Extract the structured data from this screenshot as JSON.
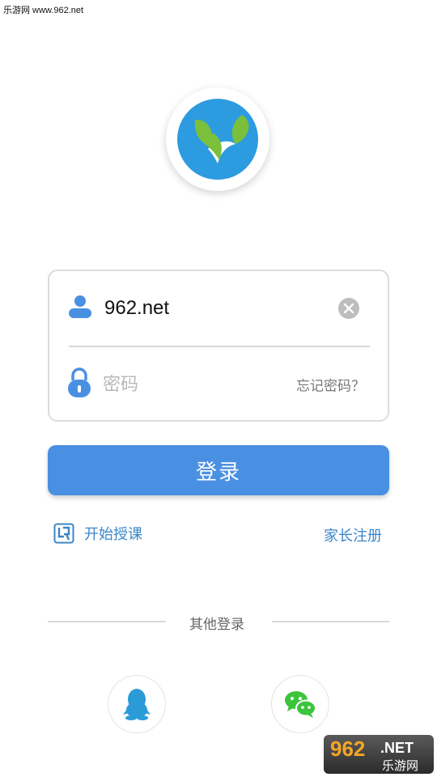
{
  "watermark": {
    "top_text": "乐游网 www.962.net",
    "badge_number": "962",
    "badge_suffix": ".NET",
    "badge_cn": "乐游网"
  },
  "login_form": {
    "username_value": "962.net",
    "password_placeholder": "密码",
    "forgot_label": "忘记密码？"
  },
  "login_button_label": "登录",
  "links": {
    "start_teaching": "开始授课",
    "parent_register": "家长注册"
  },
  "other_login": {
    "label": "其他登录",
    "providers": [
      "qq-icon",
      "wechat-icon"
    ]
  },
  "colors": {
    "accent": "#4a90e2",
    "link": "#3b86c9",
    "logo_blue": "#2d9be0",
    "logo_green": "#7bbf3b",
    "wechat_green": "#3cc43c",
    "qq_blue": "#2b9bd8"
  }
}
